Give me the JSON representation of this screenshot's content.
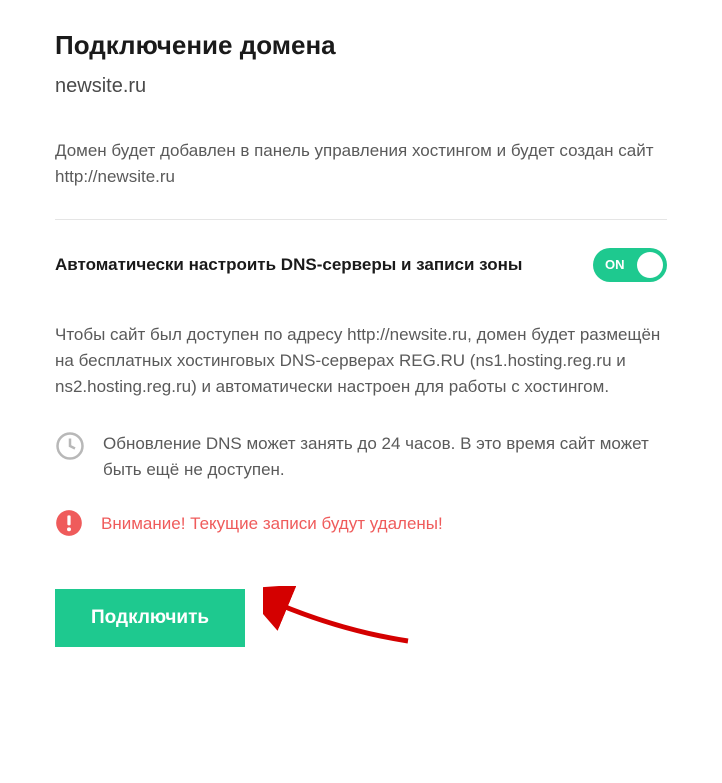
{
  "title": "Подключение домена",
  "domain": "newsite.ru",
  "description": "Домен будет добавлен в панель управления хостингом и будет создан сайт http://newsite.ru",
  "toggle": {
    "label": "Автоматически настроить DNS-серверы и записи зоны",
    "state_text": "ON",
    "on": true
  },
  "dns_explain": "Чтобы сайт был доступен по адресу http://newsite.ru, домен будет размещён на бесплатных хостинговых DNS-серверах REG.RU (ns1.hosting.reg.ru и ns2.hosting.reg.ru) и автоматически настроен для работы с хостингом.",
  "time_note": "Обновление DNS может занять до 24 часов. В это время сайт может быть ещё не доступен.",
  "warning": "Внимание! Текущие записи будут удалены!",
  "buttons": {
    "connect": "Подключить"
  },
  "colors": {
    "accent": "#1ec98f",
    "warn": "#ef5b5b"
  }
}
